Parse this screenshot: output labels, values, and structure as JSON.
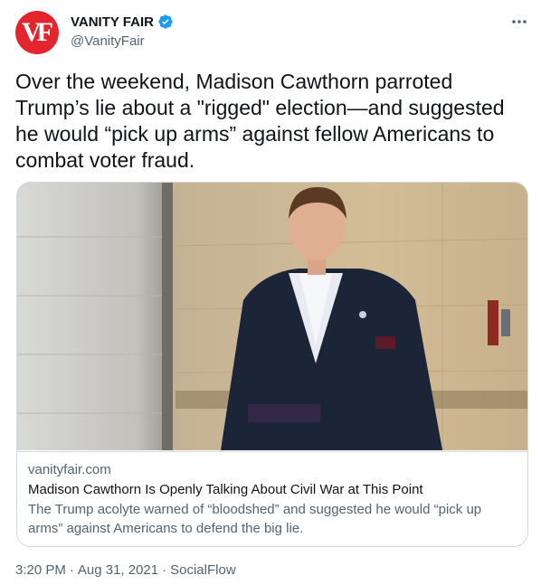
{
  "header": {
    "avatar_text": "VF",
    "display_name": "VANITY FAIR",
    "handle": "@VanityFair"
  },
  "tweet": {
    "text": "Over the weekend, Madison Cawthorn parroted Trump’s lie about a \"rigged\" election—and suggested he would “pick up arms” against fellow Americans to combat voter fraud."
  },
  "card": {
    "domain": "vanityfair.com",
    "title": "Madison Cawthorn Is Openly Talking About Civil War at This Point",
    "description": "The Trump acolyte warned of “bloodshed” and suggested he would “pick up arms” against Americans to defend the big lie."
  },
  "footer": {
    "time": "3:20 PM",
    "separator1": "·",
    "date": "Aug 31, 2021",
    "separator2": "·",
    "source": "SocialFlow"
  },
  "colors": {
    "brand_red": "#e3262e",
    "verified_blue": "#1d9bf0",
    "text_primary": "#0f1419",
    "text_secondary": "#536471",
    "border": "#cfd9de"
  },
  "icons": {
    "verified": "verified-badge-icon",
    "more": "more-horizontal-icon"
  }
}
